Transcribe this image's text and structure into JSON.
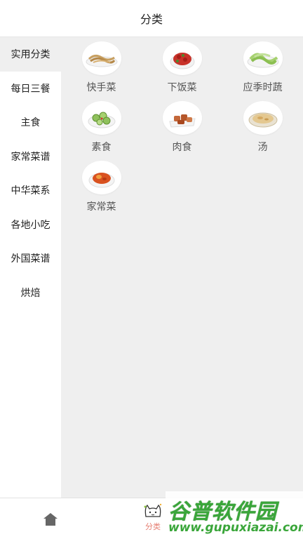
{
  "header": {
    "title": "分类"
  },
  "sidebar": {
    "items": [
      {
        "label": "实用分类",
        "active": true
      },
      {
        "label": "每日三餐",
        "active": false
      },
      {
        "label": "主食",
        "active": false
      },
      {
        "label": "家常菜谱",
        "active": false
      },
      {
        "label": "中华菜系",
        "active": false
      },
      {
        "label": "各地小吃",
        "active": false
      },
      {
        "label": "外国菜谱",
        "active": false
      },
      {
        "label": "烘焙",
        "active": false
      }
    ]
  },
  "categories": [
    {
      "label": "快手菜",
      "icon": "dish-fried-noodles-icon",
      "color": "#c8a061"
    },
    {
      "label": "下饭菜",
      "icon": "dish-red-meat-icon",
      "color": "#c8322a"
    },
    {
      "label": "应季时蔬",
      "icon": "dish-green-vegetables-icon",
      "color": "#a6d16f"
    },
    {
      "label": "素食",
      "icon": "dish-cucumber-salad-icon",
      "color": "#8fc15c"
    },
    {
      "label": "肉食",
      "icon": "dish-braised-pork-icon",
      "color": "#c4683a"
    },
    {
      "label": "汤",
      "icon": "dish-soup-icon",
      "color": "#e4c890"
    },
    {
      "label": "家常菜",
      "icon": "dish-sweet-sour-icon",
      "color": "#d95220"
    }
  ],
  "tabbar": {
    "home_icon": "home-icon",
    "category_label": "分类",
    "active_color": "#e67f73"
  },
  "watermark": {
    "top": "谷普软件园",
    "bottom": "www.gupuxiazai.com"
  }
}
